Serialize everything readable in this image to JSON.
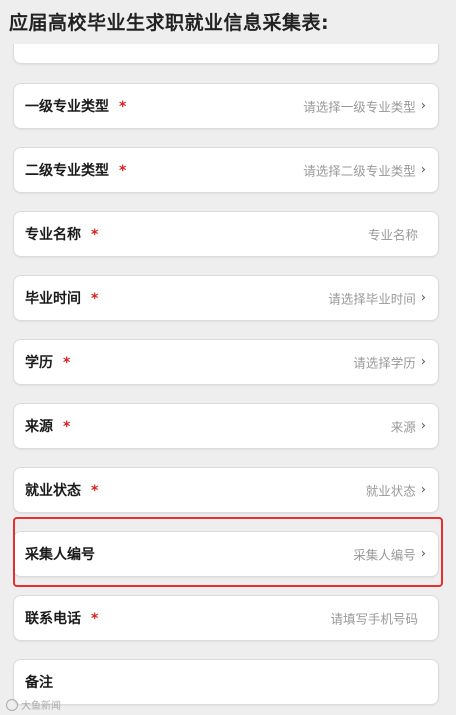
{
  "header": {
    "title": "应届高校毕业生求职就业信息采集表:"
  },
  "form": {
    "required_mark": "*",
    "rows": [
      {
        "label": "一级专业类型",
        "required": true,
        "value": "请选择一级专业类型",
        "chevron": true
      },
      {
        "label": "二级专业类型",
        "required": true,
        "value": "请选择二级专业类型",
        "chevron": true
      },
      {
        "label": "专业名称",
        "required": true,
        "value": "专业名称",
        "chevron": false
      },
      {
        "label": "毕业时间",
        "required": true,
        "value": "请选择毕业时间",
        "chevron": true
      },
      {
        "label": "学历",
        "required": true,
        "value": "请选择学历",
        "chevron": true
      },
      {
        "label": "来源",
        "required": true,
        "value": "来源",
        "chevron": true
      },
      {
        "label": "就业状态",
        "required": true,
        "value": "就业状态",
        "chevron": true
      },
      {
        "label": "采集人编号",
        "required": false,
        "value": "采集人编号",
        "chevron": true
      },
      {
        "label": "联系电话",
        "required": true,
        "value": "请填写手机号码",
        "chevron": false
      },
      {
        "label": "备注",
        "required": false,
        "value": "",
        "chevron": false
      }
    ]
  },
  "annotation": {
    "color": "#e53030",
    "target": "采集人编号"
  },
  "watermark": {
    "text": "大鱼新闻"
  }
}
